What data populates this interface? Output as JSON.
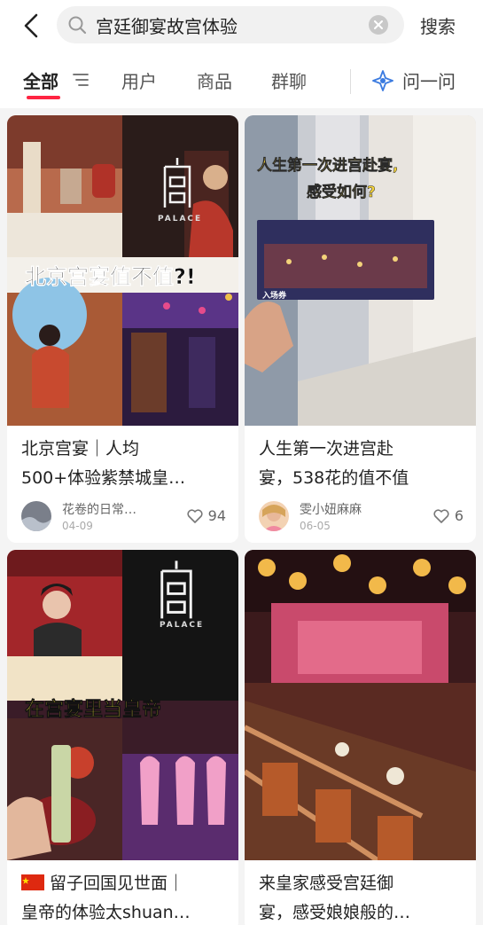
{
  "search": {
    "query": "宫廷御宴故宫体验",
    "button_label": "搜索"
  },
  "tabs": [
    {
      "label": "全部"
    },
    {
      "label": "用户"
    },
    {
      "label": "商品"
    },
    {
      "label": "群聊"
    }
  ],
  "ask_label": "问一问",
  "posts": [
    {
      "title": "北京宫宴｜人均500+体验紫禁城皇…",
      "title_line1": "北京宫宴｜人均",
      "title_line2": "500+体验紫禁城皇…",
      "cover_text": "北京宫宴值不值?!",
      "logo_text": "PALACE",
      "author": "花卷的日常…",
      "date": "04-09",
      "likes": "94"
    },
    {
      "title": "人生第一次进宫赴宴，538花的值不值",
      "title_line1": "人生第一次进宫赴",
      "title_line2": "宴，538花的值不值",
      "cover_text_line1": "人生第一次进宫赴宴,",
      "cover_text_line2": "感受如何?",
      "ticket_text": "入场券",
      "author": "雯小妞麻麻",
      "date": "06-05",
      "likes": "6"
    },
    {
      "title_line1": "留子回国见世面｜",
      "title_line2": "皇帝的体验太shuan…",
      "cover_text": "在宫宴里当皇帝",
      "logo_text": "PALACE"
    },
    {
      "title_line1": "来皇家感受宫廷御",
      "title_line2": "宴，感受娘娘般的…"
    }
  ],
  "colors": {
    "accent": "#ff2442",
    "like": "#999999"
  }
}
